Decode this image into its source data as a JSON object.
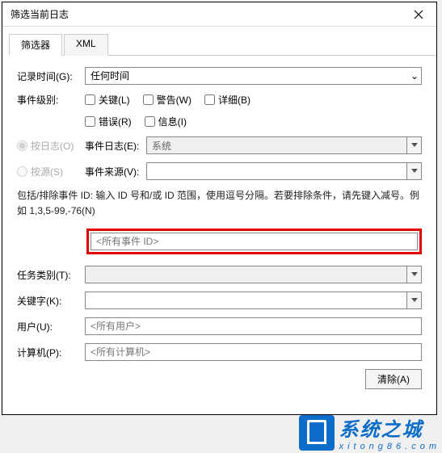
{
  "title": "筛选当前日志",
  "tabs": {
    "filter": "筛选器",
    "xml": "XML"
  },
  "rows": {
    "log_time": {
      "label": "记录时间(G):",
      "value": "任何时间"
    },
    "event_level": {
      "label": "事件级别:"
    },
    "checkboxes": {
      "critical": "关键(L)",
      "warning": "警告(W)",
      "verbose": "详细(B)",
      "error": "错误(R)",
      "info": "信息(I)"
    },
    "by_log": {
      "label": "按日志(O)",
      "sub": {
        "label": "事件日志(E):",
        "value": "系统"
      }
    },
    "by_source": {
      "label": "按源(S)",
      "sub": {
        "label": "事件来源(V):",
        "value": ""
      }
    },
    "id_desc": "包括/排除事件 ID: 输入 ID 号和/或 ID 范围，使用逗号分隔。若要排除条件，请先键入减号。例如 1,3,5-99,-76(N)",
    "id_placeholder": "<所有事件 ID>",
    "task_cat": {
      "label": "任务类别(T):"
    },
    "keywords": {
      "label": "关键字(K):"
    },
    "user": {
      "label": "用户(U):",
      "placeholder": "<所有用户>"
    },
    "computer": {
      "label": "计算机(P):",
      "placeholder": "<所有计算机>"
    }
  },
  "buttons": {
    "clear": "清除(A)"
  },
  "watermark": {
    "cn": "系统之城",
    "url": "xitong86.com"
  }
}
